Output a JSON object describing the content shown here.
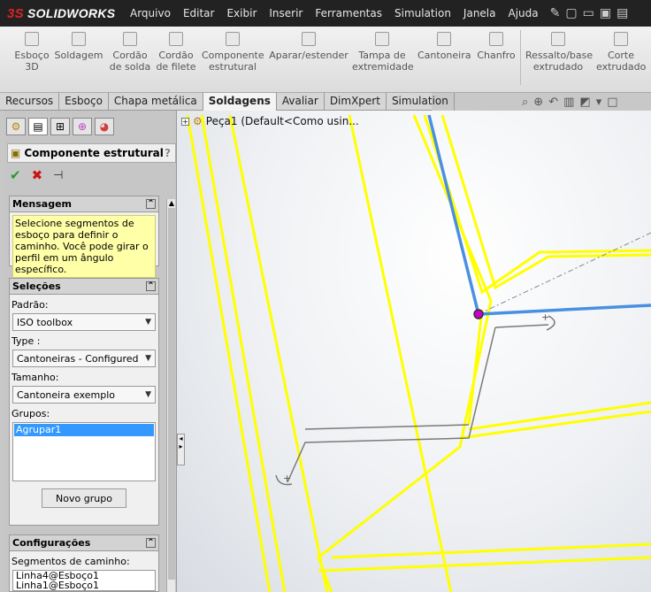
{
  "app": {
    "logo": "SOLIDWORKS",
    "logo_prefix": "3S"
  },
  "menu": [
    "Arquivo",
    "Editar",
    "Exibir",
    "Inserir",
    "Ferramentas",
    "Simulation",
    "Janela",
    "Ajuda"
  ],
  "ribbon": {
    "esboco3d": "Esboço\n3D",
    "soldagem": "Soldagem",
    "cordao_solda": "Cordão\nde solda",
    "cordao_filete": "Cordão\nde filete",
    "componente_estrutural": "Componente\nestrutural",
    "aparar": "Aparar/estender",
    "tampa": "Tampa de\nextremidade",
    "cantoneira": "Cantoneira",
    "chanfro": "Chanfro",
    "ressalto": "Ressalto/base\nextrudado",
    "corte": "Corte\nextrudado"
  },
  "tabs": [
    "Recursos",
    "Esboço",
    "Chapa metálica",
    "Soldagens",
    "Avaliar",
    "DimXpert",
    "Simulation"
  ],
  "active_tab": "Soldagens",
  "tree": {
    "part": "Peça1  (Default<Como usin..."
  },
  "property_manager": {
    "title": "Componente estrutural",
    "help": "?",
    "message": {
      "header": "Mensagem",
      "text": "Selecione segmentos de esboço para definir o caminho. Você pode girar o perfil em um ângulo específico."
    },
    "selections": {
      "header": "Seleções",
      "standard_label": "Padrão:",
      "standard_value": "ISO toolbox",
      "type_label": "Type :",
      "type_value": "Cantoneiras - Configured",
      "size_label": "Tamanho:",
      "size_value": "Cantoneira exemplo",
      "groups_label": "Grupos:",
      "groups": [
        "Agrupar1"
      ],
      "new_group": "Novo grupo"
    },
    "configurations": {
      "header": "Configurações",
      "path_label": "Segmentos de caminho:",
      "paths": [
        "Linha4@Esboço1",
        "Linha1@Esboço1"
      ]
    }
  },
  "colors": {
    "titlebar": "#222222",
    "profile": "#ffff00",
    "selected_path": "#4a90e2",
    "sketch": "#7a7a7a",
    "list_highlight": "#3399ff"
  },
  "icons": {
    "ok": "check-icon",
    "cancel": "x-icon",
    "pin": "pushpin-icon"
  }
}
